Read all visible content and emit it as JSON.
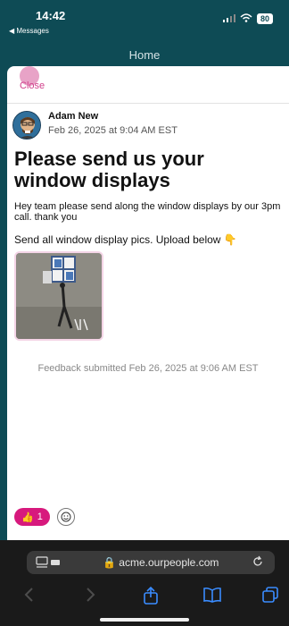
{
  "status_bar": {
    "time": "14:42",
    "back_app": "◀ Messages",
    "battery": "80"
  },
  "header": {
    "title": "Home"
  },
  "post": {
    "close_label": "Close",
    "author": "Adam New",
    "date": "Feb 26, 2025 at 9:04 AM EST",
    "title": "Please send us your window displays",
    "body": "Hey team please send along the window displays by our 3pm call. thank you",
    "body_2": "Send all window display pics. Upload below 👇",
    "feedback": "Feedback submitted Feb 26, 2025 at 9:06 AM EST"
  },
  "reactions": {
    "emoji": "👍",
    "count": "1"
  },
  "browser": {
    "url": "acme.ourpeople.com"
  },
  "colors": {
    "brand_teal": "#0e4b55",
    "accent_pink": "#d7197d"
  }
}
